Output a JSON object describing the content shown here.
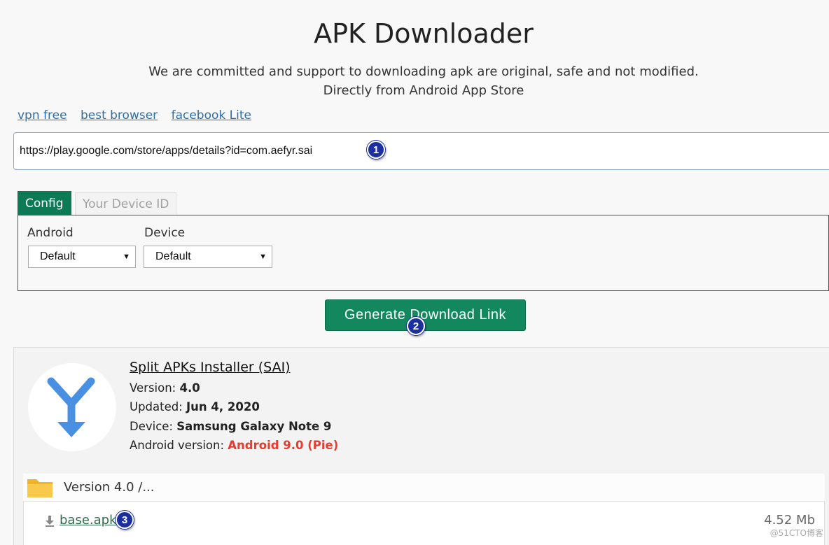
{
  "header": {
    "title": "APK Downloader",
    "subtitle_line1": "We are committed and support to downloading apk are original, safe and not modified.",
    "subtitle_line2": "Directly from Android App Store"
  },
  "quicklinks": [
    "vpn free",
    "best browser",
    "facebook Lite"
  ],
  "url_input": {
    "value": "https://play.google.com/store/apps/details?id=com.aefyr.sai"
  },
  "markers": [
    "1",
    "2",
    "3"
  ],
  "tabs": {
    "config": "Config",
    "device_id": "Your Device ID"
  },
  "config": {
    "android_label": "Android",
    "android_value": "Default",
    "device_label": "Device",
    "device_value": "Default"
  },
  "generate_button": "Generate Download Link",
  "app": {
    "name": "Split APKs Installer (SAI)",
    "version_label": "Version:",
    "version": "4.0",
    "updated_label": "Updated:",
    "updated": "Jun 4, 2020",
    "device_label": "Device:",
    "device": "Samsung Galaxy Note 9",
    "android_label": "Android version:",
    "android": "Android 9.0 (Pie)",
    "icon": "split-arrow-icon",
    "icon_color": "#4a90e2"
  },
  "files": {
    "folder": "Version 4.0 /...",
    "items": [
      {
        "name": "base.apk",
        "size": "4.52 Mb"
      }
    ]
  },
  "watermark": "@51CTO博客",
  "colors": {
    "accent": "#13875d",
    "link": "#2e6ea6",
    "highlight": "#e63b2e",
    "marker": "#1b2fa0"
  }
}
